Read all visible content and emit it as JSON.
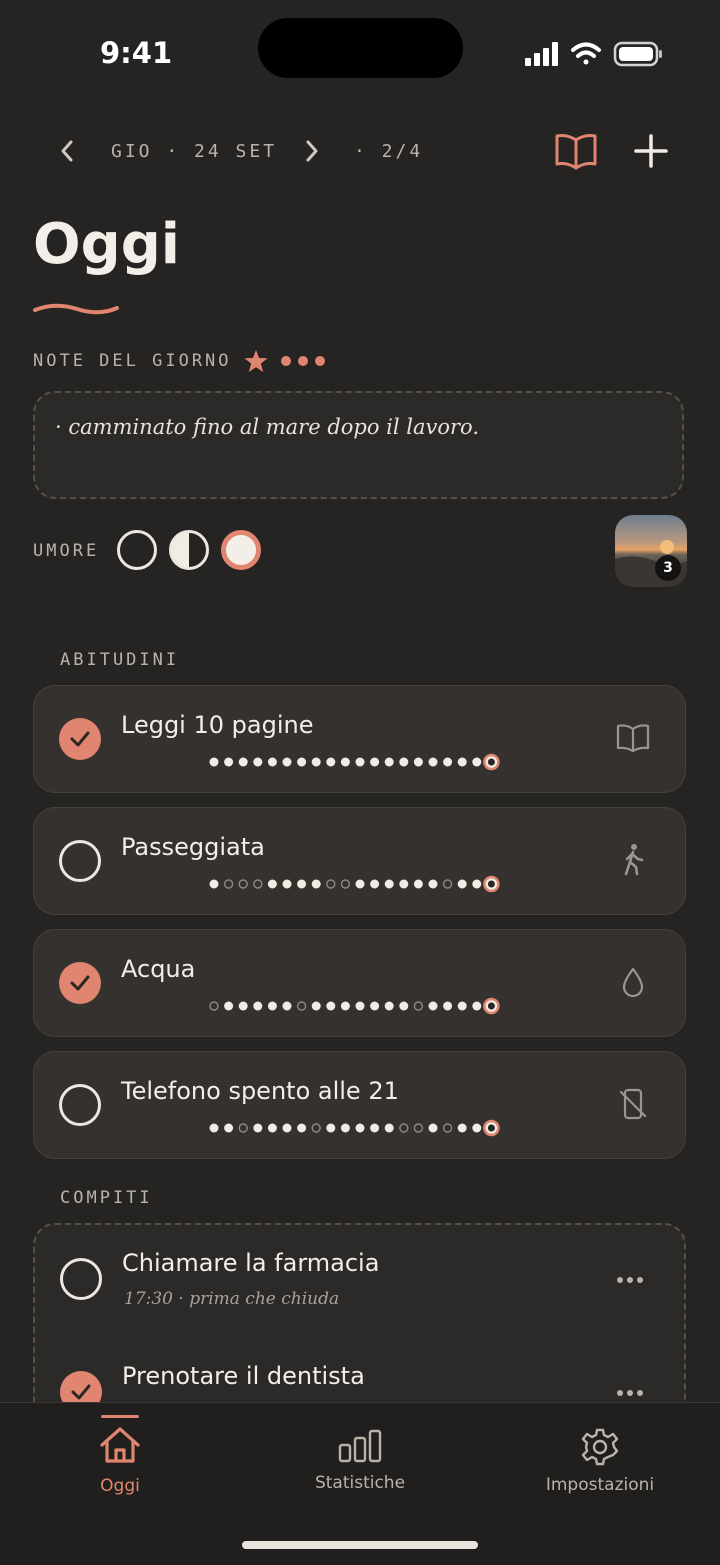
{
  "status": {
    "time": "9:41"
  },
  "header": {
    "date": "GIO · 24 SET",
    "page": "· 2/4",
    "title": "Oggi"
  },
  "notes": {
    "label": "NOTE DEL GIORNO",
    "text": "· camminato fino al mare dopo il lavoro."
  },
  "mood": {
    "label": "UMORE",
    "options": [
      "empty-circle",
      "half-circle",
      "full-circle"
    ],
    "selected_index": 2,
    "photo_count": "3"
  },
  "habits": {
    "label": "ABITUDINI",
    "items": [
      {
        "name": "Leggi 10 pagine",
        "done": true,
        "icon": "book-icon",
        "streak": [
          1,
          1,
          1,
          1,
          1,
          1,
          1,
          1,
          1,
          1,
          1,
          1,
          1,
          1,
          1,
          1,
          1,
          1,
          1,
          1
        ]
      },
      {
        "name": "Passeggiata",
        "done": false,
        "icon": "walking-icon",
        "streak": [
          1,
          0,
          0,
          0,
          1,
          1,
          1,
          1,
          0,
          0,
          1,
          1,
          1,
          1,
          1,
          1,
          0,
          1,
          1,
          1
        ]
      },
      {
        "name": "Acqua",
        "done": true,
        "icon": "water-drop-icon",
        "streak": [
          0,
          1,
          1,
          1,
          1,
          1,
          0,
          1,
          1,
          1,
          1,
          1,
          1,
          1,
          0,
          1,
          1,
          1,
          1,
          1
        ]
      },
      {
        "name": "Telefono spento alle 21",
        "done": false,
        "icon": "phone-off-icon",
        "streak": [
          1,
          1,
          0,
          1,
          1,
          1,
          1,
          0,
          1,
          1,
          1,
          1,
          1,
          0,
          0,
          1,
          0,
          1,
          1,
          1
        ]
      }
    ]
  },
  "tasks": {
    "label": "COMPITI",
    "items": [
      {
        "name": "Chiamare la farmacia",
        "sub": "17:30 · prima che chiuda",
        "done": false
      },
      {
        "name": "Prenotare il dentista",
        "sub": "",
        "done": true
      }
    ]
  },
  "tabs": [
    {
      "label": "Oggi",
      "icon": "home-icon",
      "active": true
    },
    {
      "label": "Statistiche",
      "icon": "bar-chart-icon",
      "active": false
    },
    {
      "label": "Impostazioni",
      "icon": "gear-icon",
      "active": false
    }
  ],
  "colors": {
    "accent": "#e08670",
    "background": "#262422",
    "card": "#34312f"
  }
}
